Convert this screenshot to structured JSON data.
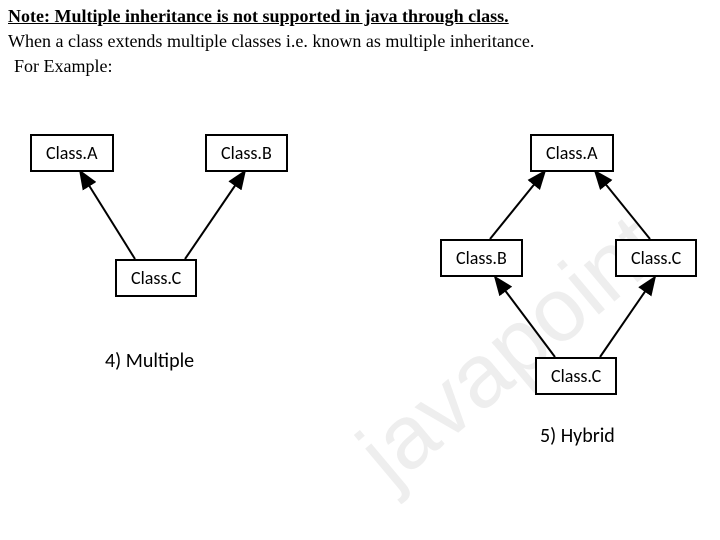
{
  "header": {
    "note": "Note: Multiple inheritance is not supported in java through class.",
    "line2": "When a class extends multiple classes i.e. known as multiple inheritance.",
    "line3": "For Example:"
  },
  "diagrams": {
    "multiple": {
      "caption": "4)  Multiple",
      "classA": "Class.A",
      "classB": "Class.B",
      "classC": "Class.C"
    },
    "hybrid": {
      "caption": "5)  Hybrid",
      "classA": "Class.A",
      "classB": "Class.B",
      "classC_right": "Class.C",
      "classC_bottom": "Class.C"
    }
  },
  "watermark": "javapoint"
}
